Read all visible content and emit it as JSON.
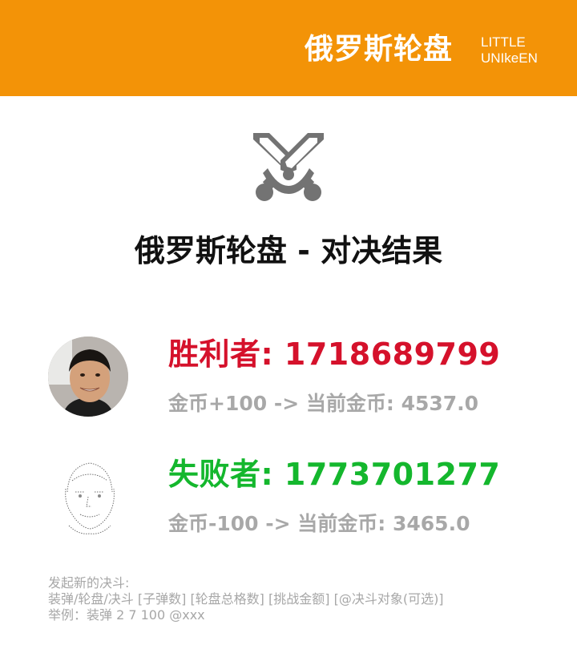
{
  "header": {
    "title": "俄罗斯轮盘",
    "brand_line1": "LITTLE",
    "brand_line2": "UNIkeEN",
    "bg_color": "#f39307"
  },
  "icon": {
    "name": "crossed-swords-icon",
    "color": "#737373"
  },
  "main_title": "俄罗斯轮盘 - 对决结果",
  "winner": {
    "title": "胜利者: 1718689799",
    "coins": "金币+100 -> 当前金币: 4537.0",
    "color": "#d5112b"
  },
  "loser": {
    "title": "失败者: 1773701277",
    "coins": "金币-100 -> 当前金币: 3465.0",
    "color": "#14b72d"
  },
  "help": {
    "line1": "发起新的决斗:",
    "line2": "装弹/轮盘/决斗 [子弹数] [轮盘总格数] [挑战金额] [@决斗对象(可选)]",
    "line3": "举例：装弹 2 7 100 @xxx"
  }
}
